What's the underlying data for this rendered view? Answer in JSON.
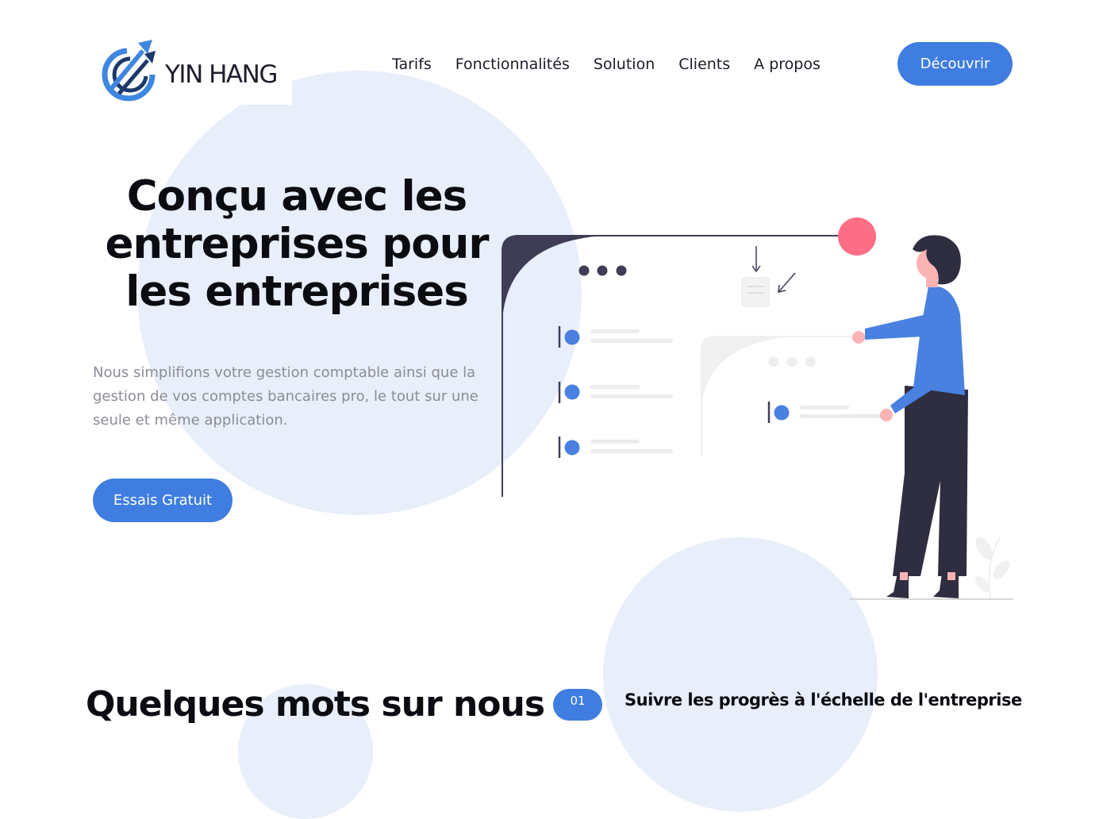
{
  "brand": {
    "name": "YIN HANG",
    "logo_icon": "rising-arrow-circle-icon",
    "logo_colors": [
      "#3f86e0",
      "#1b3a6a"
    ]
  },
  "nav": {
    "items": [
      "Tarifs",
      "Fonctionnalités",
      "Solution",
      "Clients",
      "A propos"
    ]
  },
  "header": {
    "cta_label": "Découvrir"
  },
  "hero": {
    "title": "Conçu avec les entreprises pour les entreprises",
    "subtitle": "Nous simplifions votre gestion comptable ainsi que la gestion de vos comptes bancaires pro, le tout sur une seule et même application.",
    "cta_label": "Essais Gratuit"
  },
  "features": {
    "section_title": "Quelques mots sur nous",
    "first_number": "01",
    "first_title": "Suivre les progrès à l'échelle de l'entreprise"
  },
  "colors": {
    "accent": "#3f7de0",
    "blob": "#e8eefa",
    "text_dark": "#0b0b12",
    "text_muted": "#8b8d96",
    "pink": "#fc6d86",
    "navy": "#3f3d56"
  }
}
